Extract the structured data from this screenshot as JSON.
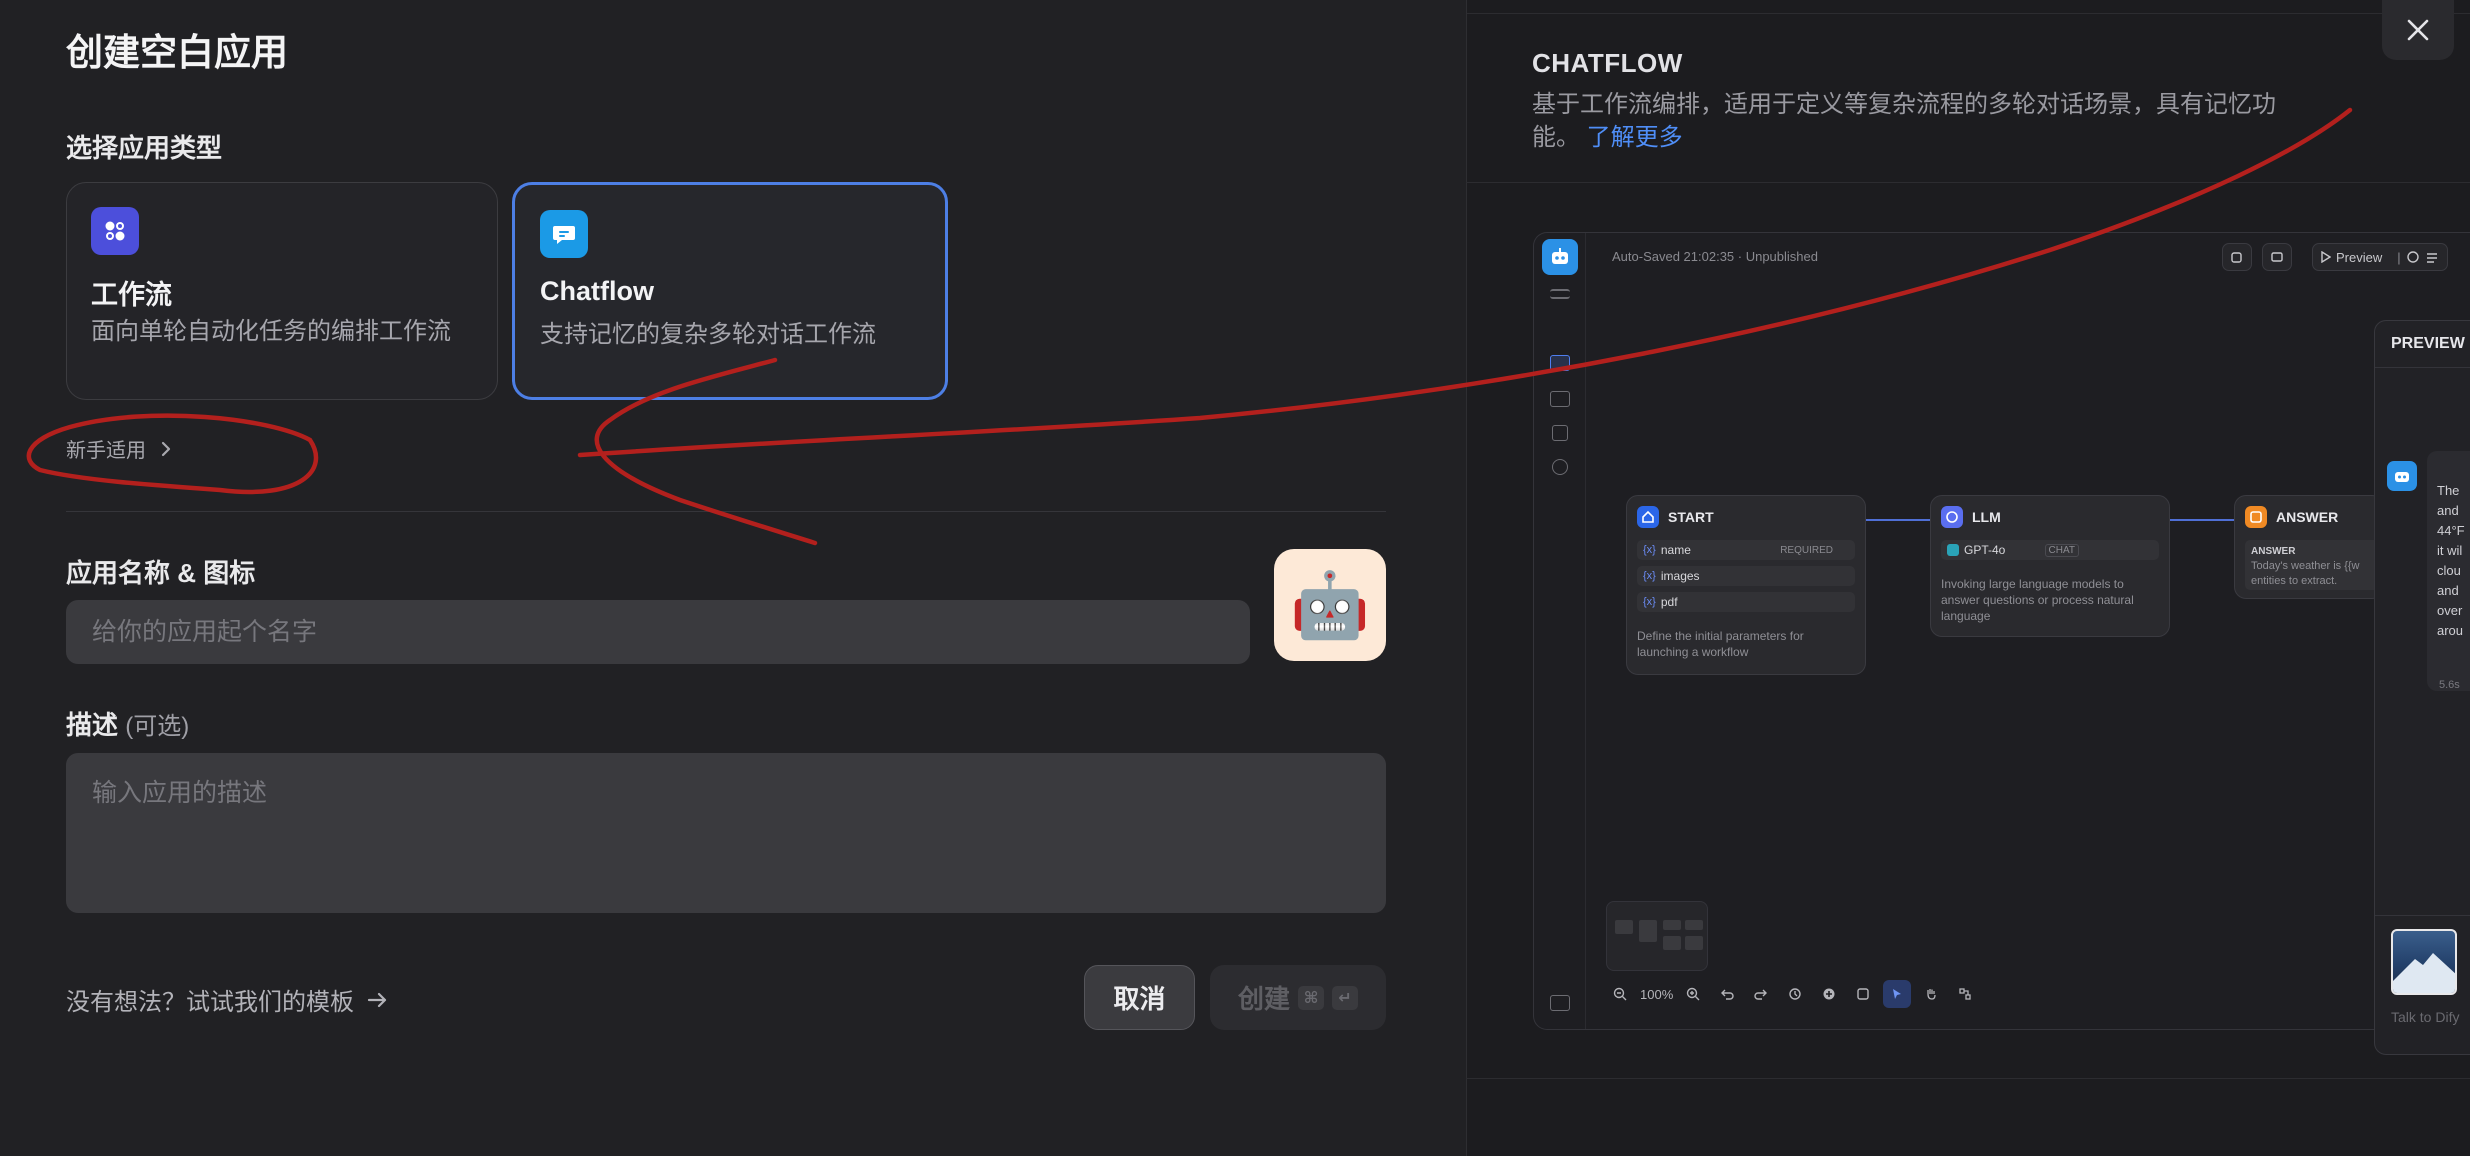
{
  "dialog": {
    "title": "创建空白应用",
    "close_icon": "close-icon"
  },
  "app_type": {
    "label": "选择应用类型",
    "cards": [
      {
        "name": "工作流",
        "description": "面向单轮自动化任务的编排工作流",
        "icon": "workflow-icon",
        "color": "#4c4fdb",
        "selected": false
      },
      {
        "name": "Chatflow",
        "description": "支持记忆的复杂多轮对话工作流",
        "icon": "chatflow-icon",
        "color": "#1b9ae6",
        "selected": true
      }
    ],
    "beginner_label": "新手适用"
  },
  "name_section": {
    "label": "应用名称 & 图标",
    "placeholder": "给你的应用起个名字",
    "icon_emoji": "🤖",
    "icon_bg": "#fde9d7"
  },
  "description_section": {
    "label": "描述",
    "optional": "(可选)",
    "placeholder": "输入应用的描述"
  },
  "footer": {
    "template_link": "没有想法？试试我们的模板",
    "cancel_label": "取消",
    "create_label": "创建",
    "shortcut_keys": [
      "⌘",
      "↵"
    ]
  },
  "preview": {
    "title": "CHATFLOW",
    "description": "基于工作流编排，适用于定义等复杂流程的多轮对话场景，具有记忆功能。",
    "learn_more": "了解更多",
    "autosave": "Auto-Saved 21:02:35 · Unpublished",
    "preview_button": "Preview",
    "zoom": "100%",
    "nodes": {
      "start": {
        "title": "START",
        "variables": [
          {
            "name": "name",
            "tag": "REQUIRED"
          },
          {
            "name": "images",
            "tag": ""
          },
          {
            "name": "pdf",
            "tag": ""
          }
        ],
        "note": "Define the initial parameters for launching a workflow"
      },
      "llm": {
        "title": "LLM",
        "model": "GPT-4o",
        "model_tag": "CHAT",
        "note": "Invoking large language models to answer questions or process natural language"
      },
      "answer": {
        "title": "ANSWER",
        "label": "ANSWER",
        "text": "Today's weather is {{w",
        "text2": "entities to extract."
      }
    },
    "panel": {
      "title": "PREVIEW",
      "message_lines": [
        "The",
        "and",
        "44°F",
        "it wil",
        "clou",
        "and",
        "over",
        "arou"
      ],
      "elapsed": "5.6s",
      "input_placeholder": "Talk to Dify"
    }
  },
  "colors": {
    "accent": "#4d7fe5",
    "link": "#4f8ef7",
    "annotation": "#b3201d"
  }
}
